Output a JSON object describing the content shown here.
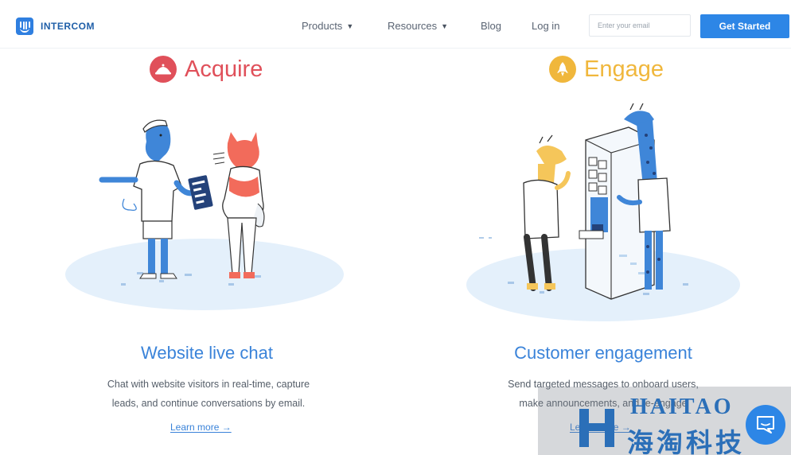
{
  "header": {
    "brand": "INTERCOM",
    "nav": [
      {
        "label": "Products",
        "dropdown": true
      },
      {
        "label": "Resources",
        "dropdown": true
      },
      {
        "label": "Blog",
        "dropdown": false
      },
      {
        "label": "Log in",
        "dropdown": false
      }
    ],
    "email_placeholder": "Enter your email",
    "cta_label": "Get Started",
    "caret_glyph": "▼"
  },
  "sections": [
    {
      "heading": "Acquire",
      "heading_color": "#e0505a",
      "icon": "dish-bell-icon",
      "title": "Website live chat",
      "description_lines": [
        "Chat with website visitors in real-time, capture",
        "leads, and continue conversations by email."
      ],
      "link": "Learn more →"
    },
    {
      "heading": "Engage",
      "heading_color": "#f0b73c",
      "icon": "rocket-icon",
      "title": "Customer engagement",
      "description_lines": [
        "Send targeted messages to onboard users,",
        "make announcements, and re-engage"
      ],
      "link": "Learn more →"
    }
  ],
  "watermark": {
    "brand": "HAITAO",
    "chinese": "海淘科技"
  },
  "colors": {
    "accent": "#2d86e6",
    "link": "#3a83d9"
  }
}
